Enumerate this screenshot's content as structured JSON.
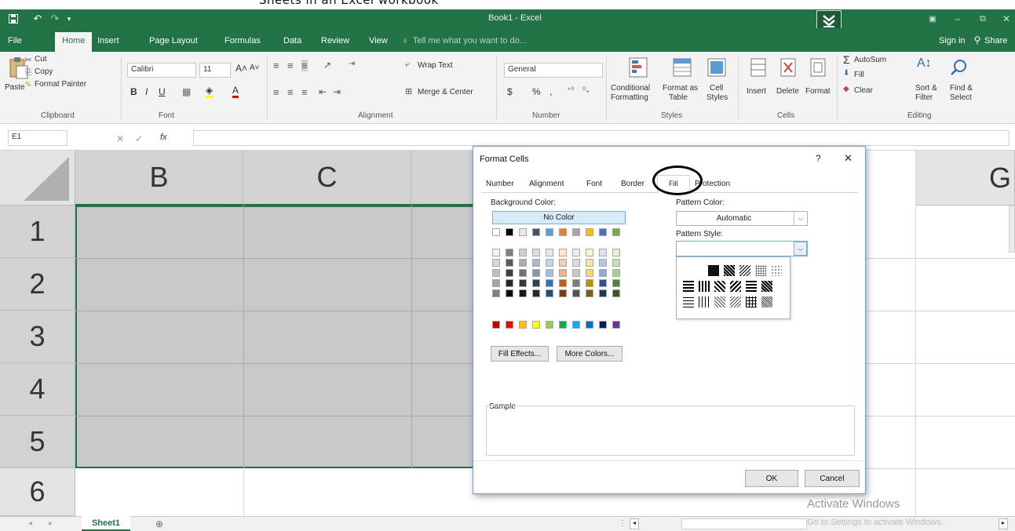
{
  "caption": "Sheets in an Excel workbook",
  "window": {
    "title": "Book1 - Excel",
    "sign_in": "Sign in",
    "share": "Share"
  },
  "menu_tabs": [
    "File",
    "Home",
    "Insert",
    "Page Layout",
    "Formulas",
    "Data",
    "Review",
    "View"
  ],
  "tell_me": "Tell me what you want to do...",
  "ribbon": {
    "clipboard": {
      "paste": "Paste",
      "cut": "Cut",
      "copy": "Copy",
      "format_painter": "Format Painter",
      "group": "Clipboard"
    },
    "font": {
      "name": "Calibri",
      "size": "11",
      "group": "Font"
    },
    "alignment": {
      "wrap": "Wrap Text",
      "merge": "Merge & Center",
      "group": "Alignment"
    },
    "number": {
      "format": "General",
      "group": "Number",
      "currency": "$",
      "percent": "%",
      "comma": ","
    },
    "styles": {
      "conditional": "Conditional",
      "formatting": "Formatting",
      "format_as": "Format as",
      "table": "Table",
      "cell": "Cell",
      "styles_label": "Styles",
      "group": "Styles"
    },
    "cells": {
      "insert": "Insert",
      "delete": "Delete",
      "format": "Format",
      "group": "Cells"
    },
    "editing": {
      "autosum": "AutoSum",
      "fill": "Fill",
      "clear": "Clear",
      "sort": "Sort &",
      "filter": "Filter",
      "find": "Find &",
      "select": "Select",
      "group": "Editing"
    }
  },
  "formula_bar": {
    "name_box": "E1",
    "fx": "fx",
    "value": ""
  },
  "grid": {
    "columns": [
      "B",
      "C",
      "G"
    ],
    "rows": [
      "1",
      "2",
      "3",
      "4",
      "5",
      "6"
    ]
  },
  "sheet_tab": "Sheet1",
  "watermark": {
    "line1": "Activate Windows",
    "line2": "Go to Settings to activate Windows."
  },
  "dialog": {
    "title": "Format Cells",
    "help": "?",
    "close": "✕",
    "tabs": [
      "Number",
      "Alignment",
      "Font",
      "Border",
      "Fill",
      "Protection"
    ],
    "active_tab": "Fill",
    "background_color_label": "Background Color:",
    "no_color": "No Color",
    "pattern_color_label": "Pattern Color:",
    "pattern_color_value": "Automatic",
    "pattern_style_label": "Pattern Style:",
    "fill_effects": "Fill Effects...",
    "more_colors": "More Colors...",
    "sample_label": "Sample",
    "ok": "OK",
    "cancel": "Cancel",
    "theme_row": [
      "#ffffff",
      "#000000",
      "#e7e6e6",
      "#44546a",
      "#5b9bd5",
      "#ed7d31",
      "#a5a5a5",
      "#ffc000",
      "#4472c4",
      "#70ad47"
    ],
    "tint_rows": [
      [
        "#f2f2f2",
        "#7f7f7f",
        "#d0cece",
        "#d6dce4",
        "#deebf6",
        "#fbe5d5",
        "#ededed",
        "#fff2cc",
        "#dae3f3",
        "#e2efd9"
      ],
      [
        "#d8d8d8",
        "#595959",
        "#aeabab",
        "#adb9ca",
        "#bdd7ee",
        "#f7cbac",
        "#dbdbdb",
        "#fee599",
        "#b4c6e7",
        "#c5e0b3"
      ],
      [
        "#bfbfbf",
        "#3f3f3f",
        "#757070",
        "#8496b0",
        "#9cc3e5",
        "#f4b183",
        "#c9c9c9",
        "#ffd965",
        "#8eaadb",
        "#a8d08d"
      ],
      [
        "#a5a5a5",
        "#262626",
        "#3a3838",
        "#323f4f",
        "#2e75b5",
        "#c55a11",
        "#7b7b7b",
        "#bf9000",
        "#2f5496",
        "#538135"
      ],
      [
        "#7f7f7f",
        "#0c0c0c",
        "#171616",
        "#222a35",
        "#1e4e79",
        "#833c0b",
        "#525252",
        "#7f6000",
        "#1f3864",
        "#375623"
      ]
    ],
    "standard_row": [
      "#c00000",
      "#ff0000",
      "#ffc000",
      "#ffff00",
      "#92d050",
      "#00b050",
      "#00b0f0",
      "#0070c0",
      "#002060",
      "#7030a0"
    ]
  },
  "colors": {
    "excel_green": "#217346",
    "selection_fill": "#c8c8c8",
    "accent_border": "#7a9cc6"
  }
}
